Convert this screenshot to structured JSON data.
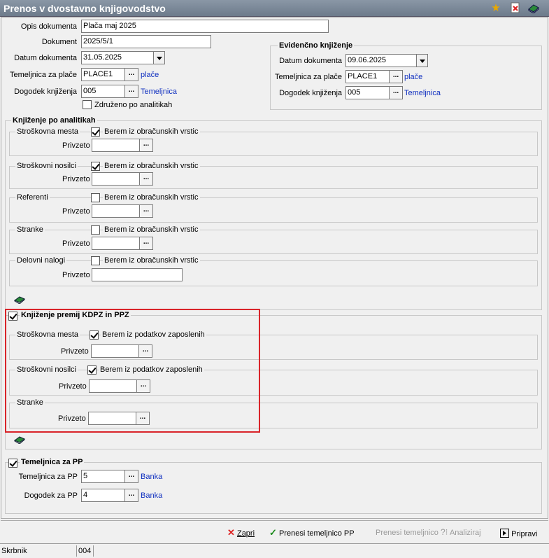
{
  "window": {
    "title": "Prenos v dvostavno knjigovodstvo"
  },
  "form": {
    "opis_label": "Opis dokumenta",
    "opis_value": "Plača maj 2025",
    "dokument_label": "Dokument",
    "dokument_value": "2025/5/1",
    "datum_label": "Datum dokumenta",
    "datum_value": "31.05.2025",
    "temeljnica_label": "Temeljnica za plače",
    "temeljnica_value": "PLACE1",
    "temeljnica_link": "plače",
    "dogodek_label": "Dogodek knjiženja",
    "dogodek_value": "005",
    "dogodek_link": "Temeljnica",
    "zdruzeno_label": "Združeno po analitikah",
    "dots": "...",
    "privzeto_label": "Privzeto"
  },
  "evidencno": {
    "title": "Evidenčno knjiženje",
    "datum_label": "Datum dokumenta",
    "datum_value": "09.06.2025",
    "temeljnica_label": "Temeljnica za plače",
    "temeljnica_value": "PLACE1",
    "temeljnica_link": "plače",
    "dogodek_label": "Dogodek knjiženja",
    "dogodek_value": "005",
    "dogodek_link": "Temeljnica"
  },
  "analitike": {
    "title": "Knjiženje po analitikah",
    "berem": "Berem iz obračunskih vrstic",
    "groups": [
      {
        "label": "Stroškovna mesta",
        "checked": true
      },
      {
        "label": "Stroškovni nosilci",
        "checked": true
      },
      {
        "label": "Referenti",
        "checked": false
      },
      {
        "label": "Stranke",
        "checked": false
      },
      {
        "label": "Delovni nalogi",
        "checked": false
      }
    ]
  },
  "kdpz": {
    "title": "Knjiženje premij KDPZ in PPZ",
    "checked": true,
    "berem": "Berem iz podatkov zaposlenih",
    "groups": [
      {
        "label": "Stroškovna mesta",
        "checked": true
      },
      {
        "label": "Stroškovni nosilci",
        "checked": true
      },
      {
        "label": "Stranke"
      }
    ]
  },
  "pp": {
    "title": "Temeljnica za PP",
    "checked": true,
    "temeljnica_label": "Temeljnica za PP",
    "temeljnica_value": "5",
    "temeljnica_link": "Banka",
    "dogodek_label": "Dogodek za PP",
    "dogodek_value": "4",
    "dogodek_link": "Banka"
  },
  "buttons": {
    "zapri": "Zapri",
    "prenesi_pp": "Prenesi temeljnico PP",
    "prenesi": "Prenesi temeljnico",
    "analiziraj": "Analiziraj",
    "pripravi": "Pripravi"
  },
  "status": {
    "user": "Skrbnik",
    "code": "004"
  },
  "colors": {
    "highlight": "#d9252a",
    "link": "#1030c0",
    "title_bar": "#7a8898"
  }
}
